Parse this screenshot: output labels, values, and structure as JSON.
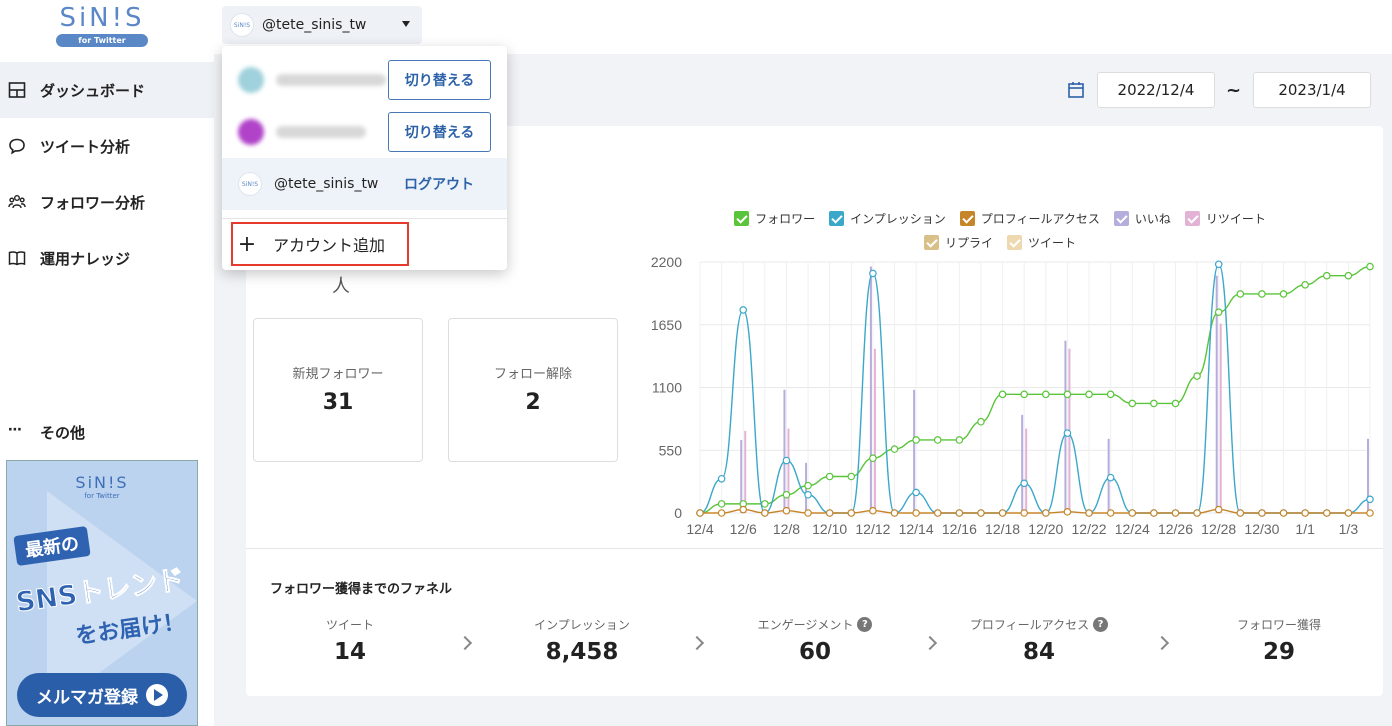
{
  "sidebar": {
    "logo_text": "SiN!S",
    "logo_sub": "for Twitter",
    "items": [
      {
        "label": "ダッシュボード",
        "icon": "dashboard-icon"
      },
      {
        "label": "ツイート分析",
        "icon": "speech-bubble-icon"
      },
      {
        "label": "フォロワー分析",
        "icon": "people-icon"
      },
      {
        "label": "運用ナレッジ",
        "icon": "book-icon"
      }
    ],
    "other_label": "その他"
  },
  "banner": {
    "logo": "SiN!S",
    "logo_sub": "for Twitter",
    "tag": "最新の",
    "headline": "SNSトレンド",
    "sub": "をお届け！",
    "button": "メルマガ登録"
  },
  "account_select": {
    "current": "@tete_sinis_tw",
    "mini_logo": "SiN!S"
  },
  "dropdown": {
    "switch_label": "切り替える",
    "current_account": "@tete_sinis_tw",
    "logout_label": "ログアウト",
    "add_account_label": "アカウント追加"
  },
  "date_range": {
    "start": "2022/12/4",
    "separator": "~",
    "end": "2023/1/4"
  },
  "followers": {
    "unit": "人",
    "new_label": "新規フォロワー",
    "new_value": "31",
    "unfollow_label": "フォロー解除",
    "unfollow_value": "2"
  },
  "legend": {
    "items": [
      {
        "label": "フォロワー",
        "color": "#5ac53a"
      },
      {
        "label": "インプレッション",
        "color": "#3ba7c9"
      },
      {
        "label": "プロフィールアクセス",
        "color": "#c7852a"
      },
      {
        "label": "いいね",
        "color": "#b5addc"
      },
      {
        "label": "リツイート",
        "color": "#e2b3d5"
      },
      {
        "label": "リプライ",
        "color": "#d8c088"
      },
      {
        "label": "ツイート",
        "color": "#eed8b0"
      }
    ]
  },
  "chart_data": {
    "type": "line",
    "x": [
      "12/4",
      "12/5",
      "12/6",
      "12/7",
      "12/8",
      "12/9",
      "12/10",
      "12/11",
      "12/12",
      "12/13",
      "12/14",
      "12/15",
      "12/16",
      "12/17",
      "12/18",
      "12/19",
      "12/20",
      "12/21",
      "12/22",
      "12/23",
      "12/24",
      "12/25",
      "12/26",
      "12/27",
      "12/28",
      "12/29",
      "12/30",
      "12/31",
      "1/1",
      "1/2",
      "1/3",
      "1/4"
    ],
    "x_tick_labels": [
      "12/4",
      "12/6",
      "12/8",
      "12/10",
      "12/12",
      "12/14",
      "12/16",
      "12/18",
      "12/20",
      "12/22",
      "12/24",
      "12/26",
      "12/28",
      "12/30",
      "1/1",
      "1/3"
    ],
    "y_ticks": [
      0,
      550,
      1100,
      1650,
      2200
    ],
    "ylim": [
      0,
      2200
    ],
    "grid": true,
    "series": [
      {
        "name": "フォロワー",
        "color": "#5ac53a",
        "values": [
          0,
          80,
          80,
          80,
          160,
          240,
          320,
          320,
          480,
          560,
          640,
          640,
          640,
          800,
          1040,
          1040,
          1040,
          1040,
          1040,
          1040,
          960,
          960,
          960,
          1200,
          1760,
          1920,
          1920,
          1920,
          2000,
          2080,
          2080,
          2160
        ]
      },
      {
        "name": "インプレッション",
        "color": "#3ba7c9",
        "values": [
          0,
          300,
          1780,
          0,
          460,
          160,
          0,
          0,
          2100,
          0,
          180,
          0,
          0,
          0,
          0,
          260,
          0,
          700,
          0,
          310,
          0,
          0,
          0,
          0,
          2180,
          0,
          0,
          0,
          0,
          0,
          0,
          120
        ]
      },
      {
        "name": "プロフィールアクセス",
        "color": "#c7852a",
        "values": [
          0,
          0,
          30,
          0,
          20,
          0,
          0,
          0,
          20,
          0,
          0,
          0,
          0,
          0,
          0,
          0,
          0,
          10,
          0,
          0,
          0,
          0,
          0,
          0,
          30,
          0,
          0,
          0,
          0,
          0,
          0,
          0
        ]
      }
    ],
    "bars": [
      {
        "name": "いいね",
        "color": "#b5addc",
        "values": [
          0,
          0,
          640,
          0,
          1080,
          440,
          0,
          0,
          2160,
          0,
          1080,
          0,
          0,
          0,
          0,
          860,
          0,
          1510,
          0,
          650,
          0,
          0,
          0,
          0,
          2080,
          0,
          0,
          0,
          0,
          0,
          0,
          650
        ]
      },
      {
        "name": "リツイート",
        "color": "#e2b3d5",
        "values": [
          0,
          0,
          720,
          0,
          740,
          0,
          0,
          0,
          1440,
          0,
          0,
          0,
          0,
          0,
          0,
          740,
          0,
          1440,
          0,
          0,
          0,
          0,
          0,
          0,
          1660,
          0,
          0,
          0,
          0,
          0,
          0,
          0
        ]
      }
    ]
  },
  "funnel": {
    "title": "フォロワー獲得までのファネル",
    "steps": [
      {
        "label": "ツイート",
        "value": "14",
        "help": false
      },
      {
        "label": "インプレッション",
        "value": "8,458",
        "help": false
      },
      {
        "label": "エンゲージメント",
        "value": "60",
        "help": true
      },
      {
        "label": "プロフィールアクセス",
        "value": "84",
        "help": true
      },
      {
        "label": "フォロワー獲得",
        "value": "29",
        "help": false
      }
    ],
    "help_glyph": "?"
  }
}
